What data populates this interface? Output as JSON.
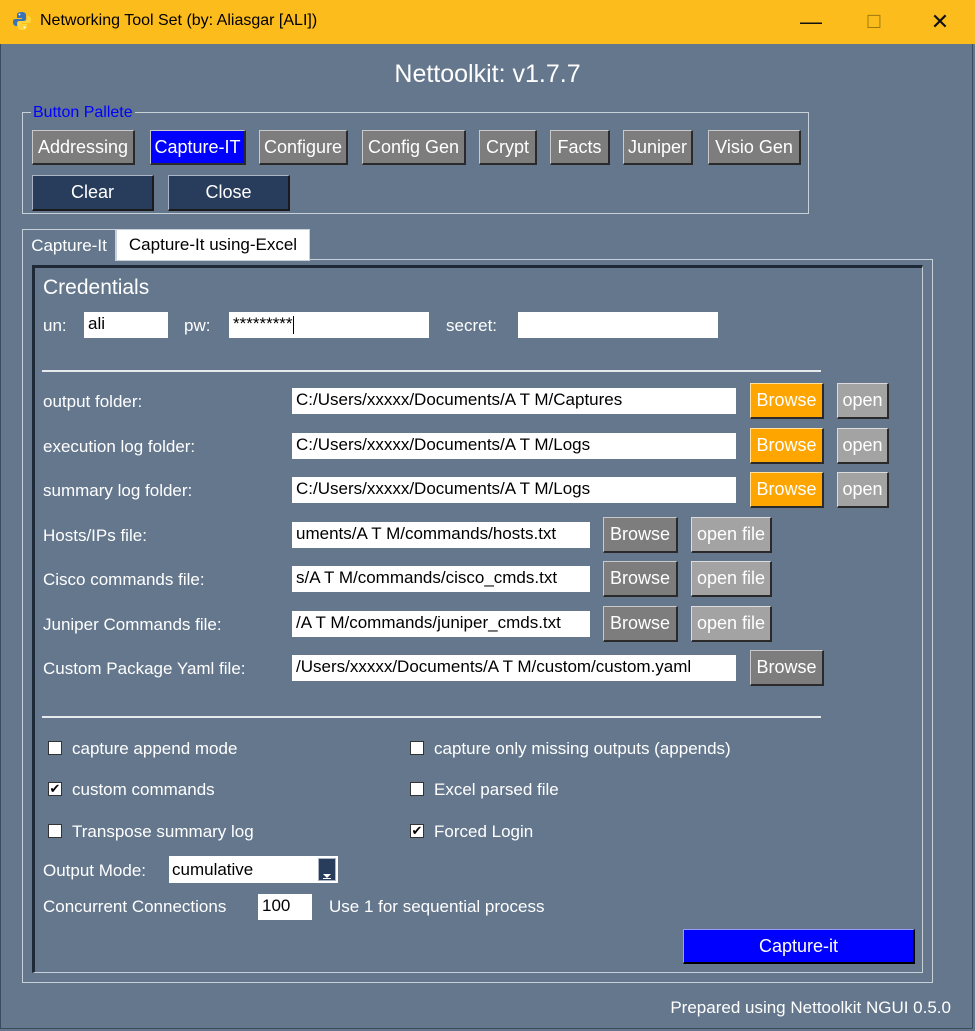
{
  "window": {
    "title": "Networking Tool Set  (by: Aliasgar [ALI])",
    "minimize": "—",
    "maximize": "☐",
    "close": "✕"
  },
  "app_title": "Nettoolkit: v1.7.7",
  "palette": {
    "legend": "Button Pallete",
    "buttons": [
      "Addressing",
      "Capture-IT",
      "Configure",
      "Config Gen",
      "Crypt",
      "Facts",
      "Juniper",
      "Visio Gen"
    ],
    "active": "Capture-IT",
    "clear": "Clear",
    "close": "Close"
  },
  "tabs": [
    "Capture-It",
    "Capture-It using-Excel"
  ],
  "credentials": {
    "heading": "Credentials",
    "un_label": "un:",
    "un_value": "ali",
    "pw_label": "pw:",
    "pw_value": "*********",
    "secret_label": "secret:",
    "secret_value": ""
  },
  "folders": [
    {
      "label": "output folder:",
      "value": "C:/Users/xxxxx/Documents/A T M/Captures",
      "browse": "Browse",
      "open": "open"
    },
    {
      "label": "execution log folder:",
      "value": "C:/Users/xxxxx/Documents/A T M/Logs",
      "browse": "Browse",
      "open": "open"
    },
    {
      "label": "summary log folder:",
      "value": "C:/Users/xxxxx/Documents/A T M/Logs",
      "browse": "Browse",
      "open": "open"
    }
  ],
  "files": [
    {
      "label": "Hosts/IPs file:",
      "value": "uments/A T M/commands/hosts.txt",
      "browse": "Browse",
      "open": "open file"
    },
    {
      "label": "Cisco commands file:",
      "value": "s/A T M/commands/cisco_cmds.txt",
      "browse": "Browse",
      "open": "open file"
    },
    {
      "label": "Juniper Commands file:",
      "value": "/A T M/commands/juniper_cmds.txt",
      "browse": "Browse",
      "open": "open file"
    }
  ],
  "custom_yaml": {
    "label": "Custom Package Yaml file:",
    "value": "/Users/xxxxx/Documents/A T M/custom/custom.yaml",
    "browse": "Browse"
  },
  "options": [
    {
      "label": "capture append mode",
      "checked": false
    },
    {
      "label": "capture only missing outputs (appends)",
      "checked": false
    },
    {
      "label": "custom commands",
      "checked": true
    },
    {
      "label": "Excel parsed file",
      "checked": false
    },
    {
      "label": "Transpose summary log",
      "checked": false
    },
    {
      "label": "Forced Login",
      "checked": true
    }
  ],
  "check_mark": "✔",
  "output_mode": {
    "label": "Output Mode:",
    "value": "cumulative"
  },
  "concurrent": {
    "label": "Concurrent Connections",
    "value": "100",
    "hint": "Use 1 for sequential process"
  },
  "capture_button": "Capture-it",
  "footer": "Prepared using Nettoolkit NGUI 0.5.0"
}
